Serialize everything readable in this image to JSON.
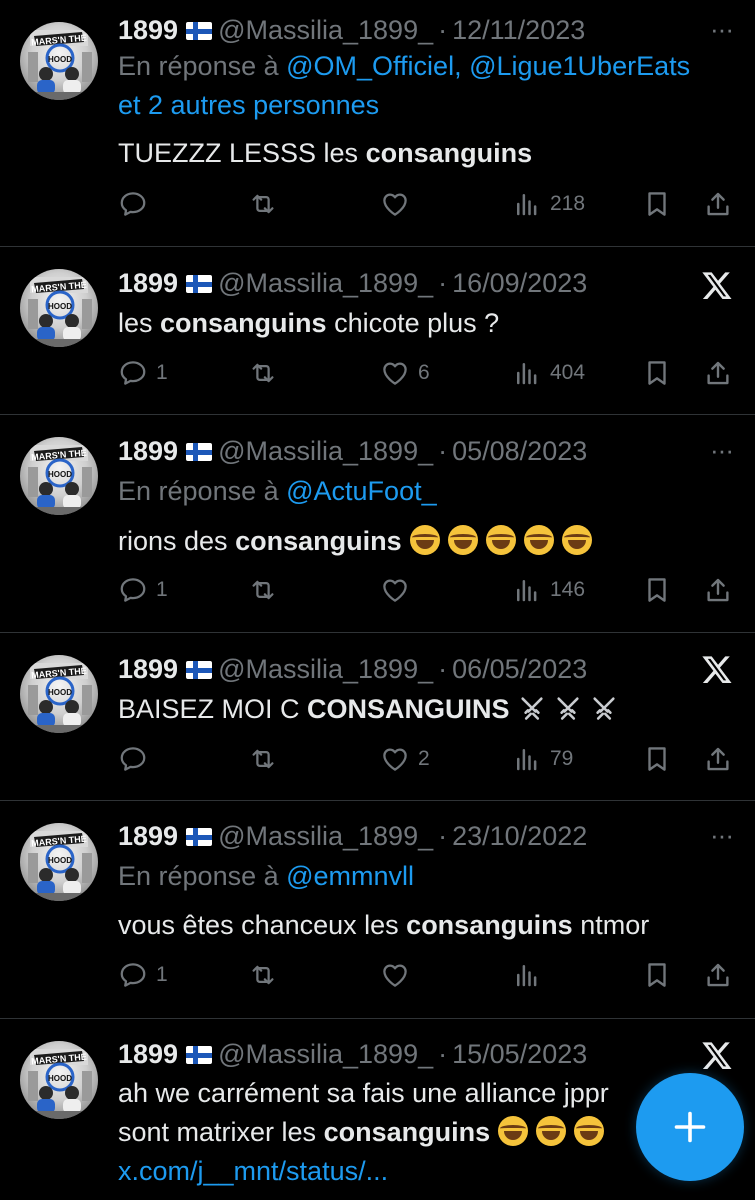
{
  "tweets": [
    {
      "name": "1899",
      "handle": "@Massilia_1899_",
      "date": "12/11/2023",
      "reply_prefix": "En réponse à ",
      "reply_to": "@OM_Officiel, @Ligue1UberEats",
      "reply_more": "et 2 autres personnes",
      "text_before": "TUEZZZ LESSS les ",
      "text_bold": "consanguins",
      "text_after": "",
      "replies": "",
      "likes": "",
      "views": "218",
      "corner": "more"
    },
    {
      "name": "1899",
      "handle": "@Massilia_1899_",
      "date": "16/09/2023",
      "text_before": "les ",
      "text_bold": "consanguins",
      "text_after": " chicote plus ?",
      "replies": "1",
      "likes": "6",
      "views": "404",
      "corner": "x"
    },
    {
      "name": "1899",
      "handle": "@Massilia_1899_",
      "date": "05/08/2023",
      "reply_prefix": "En réponse à ",
      "reply_to": "@ActuFoot_",
      "text_before": "rions des ",
      "text_bold": "consanguins",
      "text_after": "",
      "replies": "1",
      "likes": "",
      "views": "146",
      "corner": "more"
    },
    {
      "name": "1899",
      "handle": "@Massilia_1899_",
      "date": "06/05/2023",
      "text_before": "BAISEZ MOI C ",
      "text_bold": "CONSANGUINS",
      "text_after": "",
      "replies": "",
      "likes": "2",
      "views": "79",
      "corner": "x"
    },
    {
      "name": "1899",
      "handle": "@Massilia_1899_",
      "date": "23/10/2022",
      "reply_prefix": "En réponse à ",
      "reply_to": "@emmnvll",
      "text_before": "vous êtes chanceux les ",
      "text_bold": "consanguins",
      "text_after": " ntmor",
      "replies": "1",
      "likes": "",
      "views": "",
      "corner": "more"
    },
    {
      "name": "1899",
      "handle": "@Massilia_1899_",
      "date": "15/05/2023",
      "line1": "ah we carrément sa fais une alliance jppr",
      "text_before": "sont matrixer les ",
      "text_bold": "consanguins",
      "link": "x.com/j__mnt/status/...",
      "corner": "x"
    }
  ],
  "separator": "·",
  "more_glyph": "···",
  "colors": {
    "background": "#000000",
    "text": "#e7e9ea",
    "muted": "#71767b",
    "link": "#1d9bf0",
    "fab": "#1d9bf0"
  },
  "icons": [
    "reply-icon",
    "retweet-icon",
    "like-icon",
    "views-icon",
    "bookmark-icon",
    "share-icon",
    "x-logo-icon",
    "more-icon",
    "compose-icon"
  ]
}
